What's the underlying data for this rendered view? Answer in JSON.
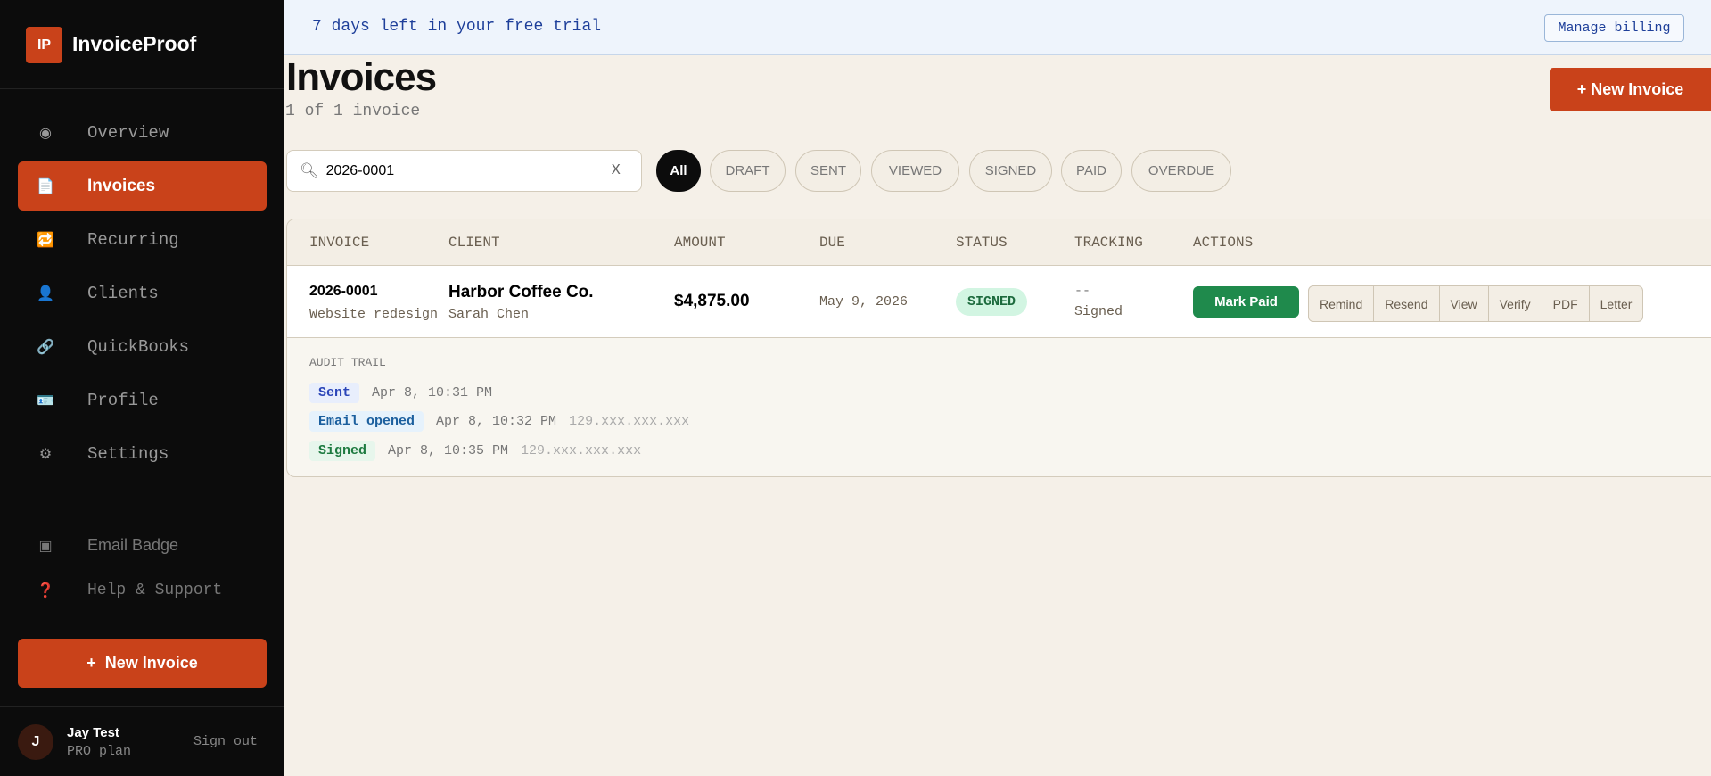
{
  "sidebar": {
    "logo_mark": "IP",
    "app_name": "InvoiceProof",
    "items": [
      {
        "label": "Overview",
        "icon": "eye-icon",
        "glyph": "◉"
      },
      {
        "label": "Invoices",
        "icon": "document-icon",
        "glyph": "📄"
      },
      {
        "label": "Recurring",
        "icon": "repeat-icon",
        "glyph": "🔁"
      },
      {
        "label": "Clients",
        "icon": "user-icon",
        "glyph": "👤"
      },
      {
        "label": "QuickBooks",
        "icon": "link-icon",
        "glyph": "🔗"
      },
      {
        "label": "Profile",
        "icon": "id-card-icon",
        "glyph": "🪪"
      },
      {
        "label": "Settings",
        "icon": "gear-icon",
        "glyph": "⚙"
      }
    ],
    "secondary": [
      {
        "label": "Email Badge",
        "icon": "badge-icon",
        "glyph": "▣"
      },
      {
        "label": "Help & Support",
        "icon": "question-icon",
        "glyph": "❓"
      }
    ],
    "new_invoice_plus": "+",
    "new_invoice_label": "New Invoice",
    "user": {
      "initial": "J",
      "name": "Jay Test",
      "plan": "PRO plan",
      "sign_out": "Sign out"
    }
  },
  "banner": {
    "text": "7 days left in your free trial",
    "button": "Manage billing"
  },
  "header": {
    "title": "Invoices",
    "count": "1 of 1 invoice",
    "new_button": "+ New Invoice"
  },
  "search": {
    "value": "2026-0001",
    "clear": "X"
  },
  "filters": [
    "All",
    "DRAFT",
    "SENT",
    "VIEWED",
    "SIGNED",
    "PAID",
    "OVERDUE"
  ],
  "active_filter": "All",
  "table": {
    "columns": [
      "INVOICE",
      "CLIENT",
      "AMOUNT",
      "DUE",
      "STATUS",
      "TRACKING",
      "ACTIONS"
    ],
    "rows": [
      {
        "invoice": "2026-0001",
        "description": "Website redesign",
        "client": "Harbor Coffee Co.",
        "contact": "Sarah Chen",
        "amount": "$4,875.00",
        "due": "May 9, 2026",
        "status": "SIGNED",
        "tracking_top": "--",
        "tracking": "Signed",
        "primary_action": "Mark Paid",
        "actions": [
          "Remind",
          "Resend",
          "View",
          "Verify",
          "PDF",
          "Letter"
        ]
      }
    ]
  },
  "audit": {
    "label": "AUDIT TRAIL",
    "events": [
      {
        "event": "Sent",
        "time": "Apr 8, 10:31 PM",
        "ip": "",
        "color": "#2b45b8",
        "bg": "#e8eefc"
      },
      {
        "event": "Email opened",
        "time": "Apr 8, 10:32 PM",
        "ip": "129.xxx.xxx.xxx",
        "color": "#1b5f9e",
        "bg": "#e6f2fc"
      },
      {
        "event": "Signed",
        "time": "Apr 8, 10:35 PM",
        "ip": "129.xxx.xxx.xxx",
        "color": "#1d7a40",
        "bg": "#e7f6ec"
      }
    ]
  },
  "colors": {
    "accent": "#c9421a",
    "success": "#1f8a4c",
    "sidebar_bg": "#0c0c0c"
  }
}
